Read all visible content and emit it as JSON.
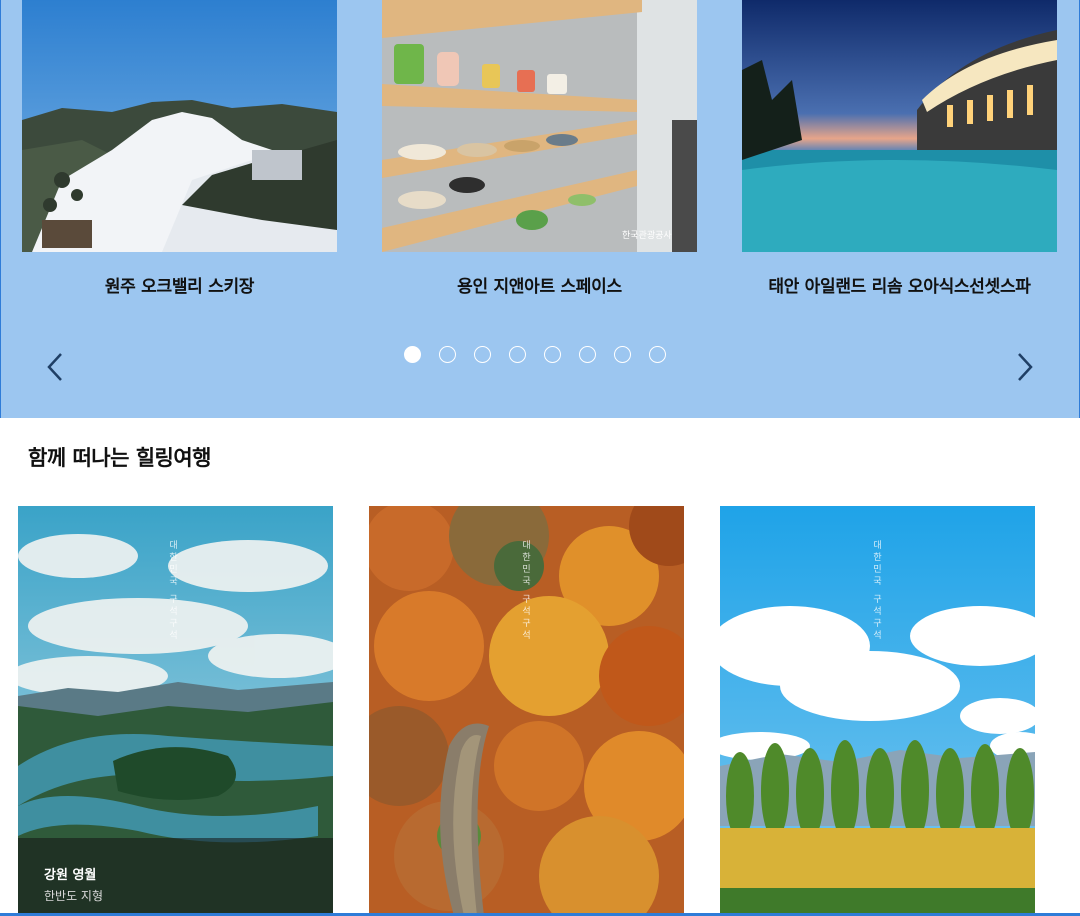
{
  "carousel": {
    "slides": [
      {
        "caption": "원주 오크밸리 스키장"
      },
      {
        "caption": "용인 지앤아트 스페이스"
      },
      {
        "caption": "태안 아일랜드 리솜 오아식스선셋스파"
      }
    ],
    "page_count": 8,
    "active_index": 0,
    "watermark": "한국관광공사"
  },
  "healing": {
    "title": "함께 떠나는 힐링여행",
    "cards": [
      {
        "region": "강원 영월",
        "place": "한반도 지형",
        "vertical_text": "대한민국 구석구석"
      },
      {
        "vertical_text": "대한민국 구석구석"
      },
      {
        "vertical_text": "대한민국 구석구석"
      }
    ]
  },
  "colors": {
    "band": "#9cc6f0",
    "accent": "#2f7cd8"
  },
  "icons": {
    "prev": "chevron-left-icon",
    "next": "chevron-right-icon"
  }
}
